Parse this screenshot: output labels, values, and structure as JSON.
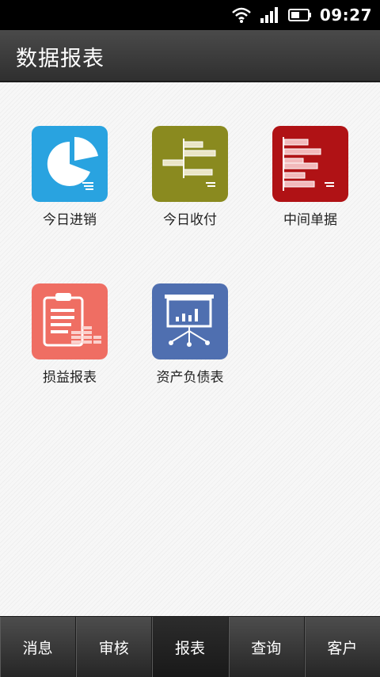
{
  "status_bar": {
    "time": "09:27"
  },
  "header": {
    "title": "数据报表"
  },
  "tiles": [
    {
      "label": "今日进销",
      "color": "#29a3e0",
      "icon": "pie-chart-icon"
    },
    {
      "label": "今日收付",
      "color": "#8a8a1f",
      "icon": "horizontal-bar-chart-icon"
    },
    {
      "label": "中间单据",
      "color": "#b01215",
      "icon": "bar-list-icon"
    },
    {
      "label": "损益报表",
      "color": "#ef6e63",
      "icon": "clipboard-icon"
    },
    {
      "label": "资产负债表",
      "color": "#4f6fb0",
      "icon": "presentation-board-icon"
    }
  ],
  "tabs": [
    {
      "label": "消息",
      "active": false
    },
    {
      "label": "审核",
      "active": false
    },
    {
      "label": "报表",
      "active": true
    },
    {
      "label": "查询",
      "active": false
    },
    {
      "label": "客户",
      "active": false
    }
  ]
}
